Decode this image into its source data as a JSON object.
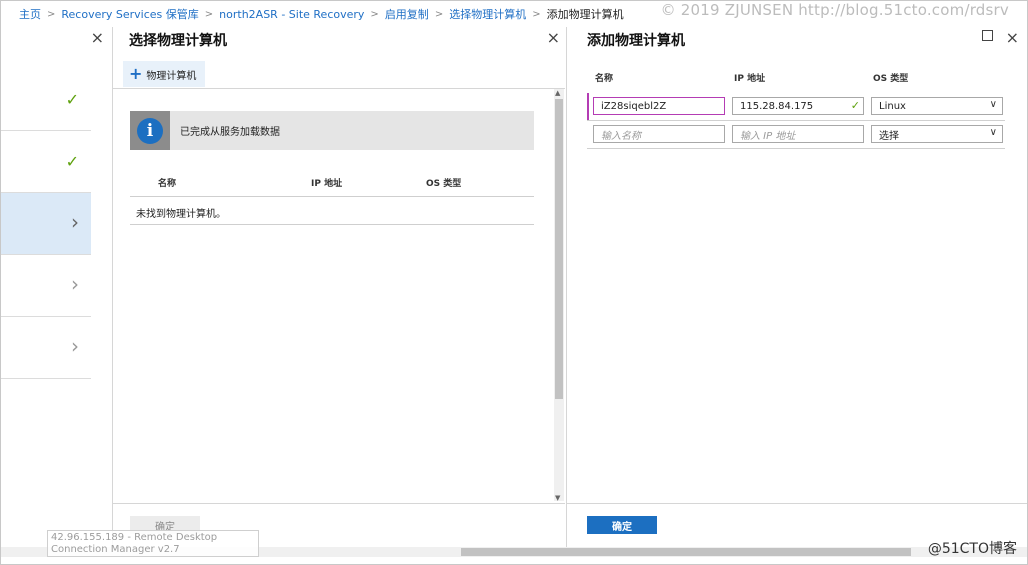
{
  "breadcrumb": {
    "items": [
      "主页",
      "Recovery Services 保管库",
      "north2ASR - Site Recovery",
      "启用复制",
      "选择物理计算机"
    ],
    "current": "添加物理计算机"
  },
  "watermark": "© 2019 ZJUNSEN http://blog.51cto.com/rdsrv",
  "left_blade": {
    "close_icon": "×",
    "items": [
      {
        "state": "complete",
        "icon": "checkmark-icon",
        "glyph": "✓"
      },
      {
        "state": "complete",
        "icon": "checkmark-icon",
        "glyph": "✓"
      },
      {
        "state": "selected",
        "icon": "chevron-right-icon",
        "glyph": "›"
      },
      {
        "state": "default",
        "icon": "chevron-right-icon",
        "glyph": "›"
      },
      {
        "state": "default",
        "icon": "chevron-right-icon",
        "glyph": "›"
      }
    ]
  },
  "select_blade": {
    "title": "选择物理计算机",
    "close_icon": "×",
    "add_button": {
      "icon": "+",
      "label": "物理计算机"
    },
    "info_banner": {
      "icon": "i",
      "text": "已完成从服务加载数据"
    },
    "table": {
      "columns": [
        "名称",
        "IP 地址",
        "OS 类型"
      ],
      "empty_message": "未找到物理计算机。"
    },
    "ok_button": "确定"
  },
  "add_blade": {
    "title": "添加物理计算机",
    "close_icon": "×",
    "columns": [
      "名称",
      "IP 地址",
      "OS 类型"
    ],
    "rows": [
      {
        "name": "iZ28siqebl2Z",
        "ip": "115.28.84.175",
        "os": "Linux",
        "ip_valid": true
      },
      {
        "name_placeholder": "输入名称",
        "ip_placeholder": "输入 IP 地址",
        "os": "选择"
      }
    ],
    "confirm_button": "确定"
  },
  "rdp_tooltip": "42.96.155.189 - Remote Desktop Connection Manager v2.7",
  "brand_logo": "@51CTO博客",
  "colors": {
    "accent_blue": "#1c6fc1",
    "link_blue": "#1f6fc5",
    "success_green": "#5ea10d",
    "invalid_magenta": "#b43cb4",
    "selected_bg": "#dbe9f7"
  }
}
